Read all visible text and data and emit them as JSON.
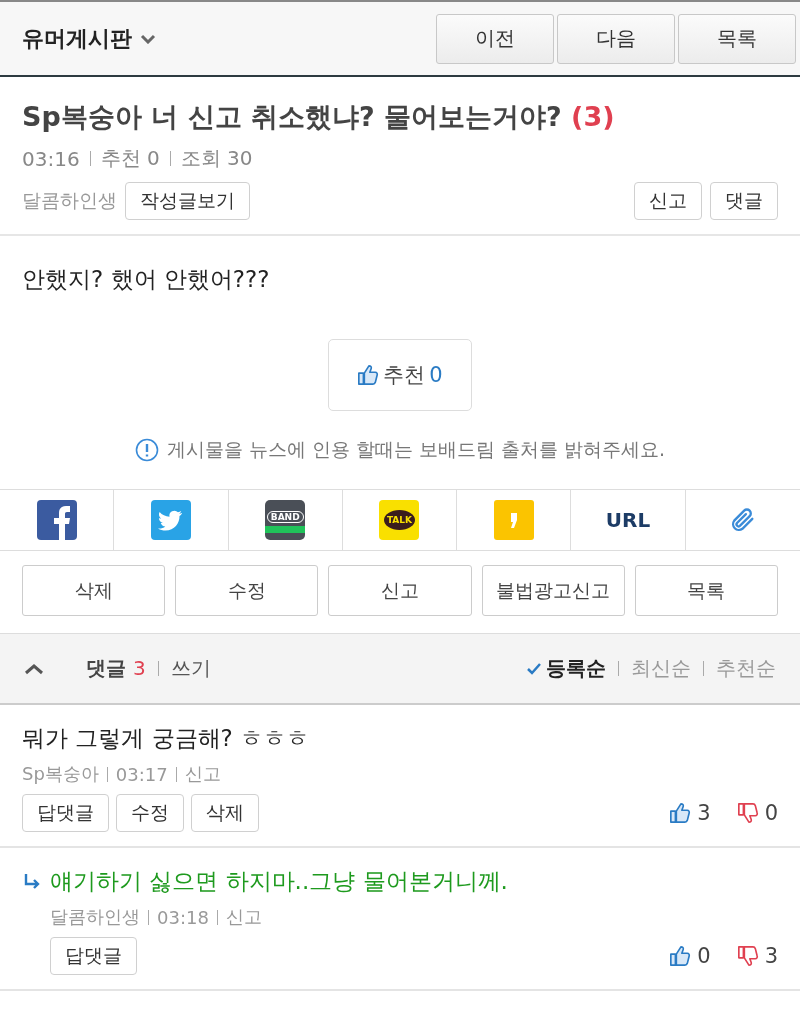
{
  "header": {
    "board": "유머게시판",
    "nav_buttons": [
      "이전",
      "다음",
      "목록"
    ]
  },
  "post": {
    "title": "Sp복숭아 너 신고 취소했냐? 물어보는거야?",
    "comment_count": "(3)",
    "meta": [
      "03:16",
      "추천 0",
      "조회 30"
    ],
    "author": "달콤하인생",
    "author_button": "작성글보기",
    "right_buttons": [
      "신고",
      "댓글"
    ],
    "body": "안했지? 했어 안했어???",
    "recommend": {
      "label": "추천",
      "count": "0"
    },
    "notice": "게시물을 뉴스에 인용 할때는 보배드림 출처를 밝혀주세요."
  },
  "share": [
    {
      "kind": "facebook"
    },
    {
      "kind": "twitter"
    },
    {
      "kind": "band",
      "label": "BAND"
    },
    {
      "kind": "talk",
      "label": "TALK"
    },
    {
      "kind": "story"
    },
    {
      "kind": "url",
      "label": "URL"
    },
    {
      "kind": "clip"
    }
  ],
  "actions": [
    "삭제",
    "수정",
    "신고",
    "불법광고신고",
    "목록"
  ],
  "comments_header": {
    "label": "댓글",
    "count": "3",
    "write": "쓰기",
    "sort": [
      {
        "label": "등록순",
        "selected": true
      },
      {
        "label": "최신순",
        "selected": false
      },
      {
        "label": "추천순",
        "selected": false
      }
    ]
  },
  "comments": [
    {
      "kind": "comment",
      "text": "뭐가 그렇게 궁금해? ㅎㅎㅎ",
      "author": "Sp복숭아",
      "time": "03:17",
      "report": "신고",
      "buttons": [
        "답댓글",
        "수정",
        "삭제"
      ],
      "likes": "3",
      "dislikes": "0"
    },
    {
      "kind": "reply",
      "text": "얘기하기 싫으면 하지마..그냥 물어본거니께.",
      "author": "달콤하인생",
      "time": "03:18",
      "report": "신고",
      "buttons": [
        "답댓글"
      ],
      "likes": "0",
      "dislikes": "3"
    }
  ]
}
